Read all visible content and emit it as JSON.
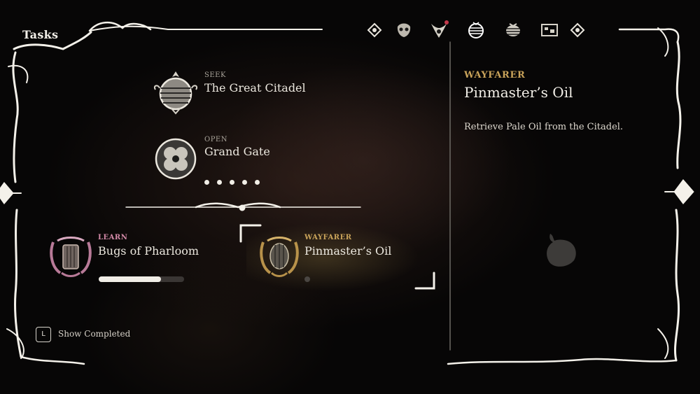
{
  "header": {
    "title": "Tasks"
  },
  "tabs": [
    {
      "name": "inventory",
      "icon": "left-diamond-icon",
      "active": false
    },
    {
      "name": "crest",
      "icon": "skull-crest-icon",
      "active": false
    },
    {
      "name": "tools",
      "icon": "horned-beetle-icon",
      "active": false,
      "notification": true
    },
    {
      "name": "tasks",
      "icon": "citadel-orb-icon",
      "active": true
    },
    {
      "name": "journal",
      "icon": "bug-journal-icon",
      "active": false
    },
    {
      "name": "map",
      "icon": "map-icon",
      "active": false
    },
    {
      "name": "next",
      "icon": "right-diamond-icon",
      "active": false
    }
  ],
  "main_tasks": [
    {
      "kind": "SEEK",
      "name": "The Great Citadel",
      "icon": "citadel-orb-icon"
    },
    {
      "kind": "OPEN",
      "name": "Grand Gate",
      "icon": "gate-seal-icon",
      "pips": 5
    }
  ],
  "side_tasks": [
    {
      "kind": "LEARN",
      "name": "Bugs of Pharloom",
      "icon": "pink-harp-icon",
      "progress": 0.73
    },
    {
      "kind": "WAYFARER",
      "name": "Pinmaster’s Oil",
      "icon": "gold-harp-icon",
      "progress": 0,
      "selected": true
    }
  ],
  "detail": {
    "kind": "WAYFARER",
    "name": "Pinmaster’s Oil",
    "description": "Retrieve Pale Oil from the Citadel.",
    "icon": "oil-flask-icon"
  },
  "footer": {
    "key": "L",
    "label": "Show Completed"
  },
  "colors": {
    "wayfarer": "#c9a35a",
    "learn": "#d48aa8",
    "notification": "#c2384a"
  }
}
